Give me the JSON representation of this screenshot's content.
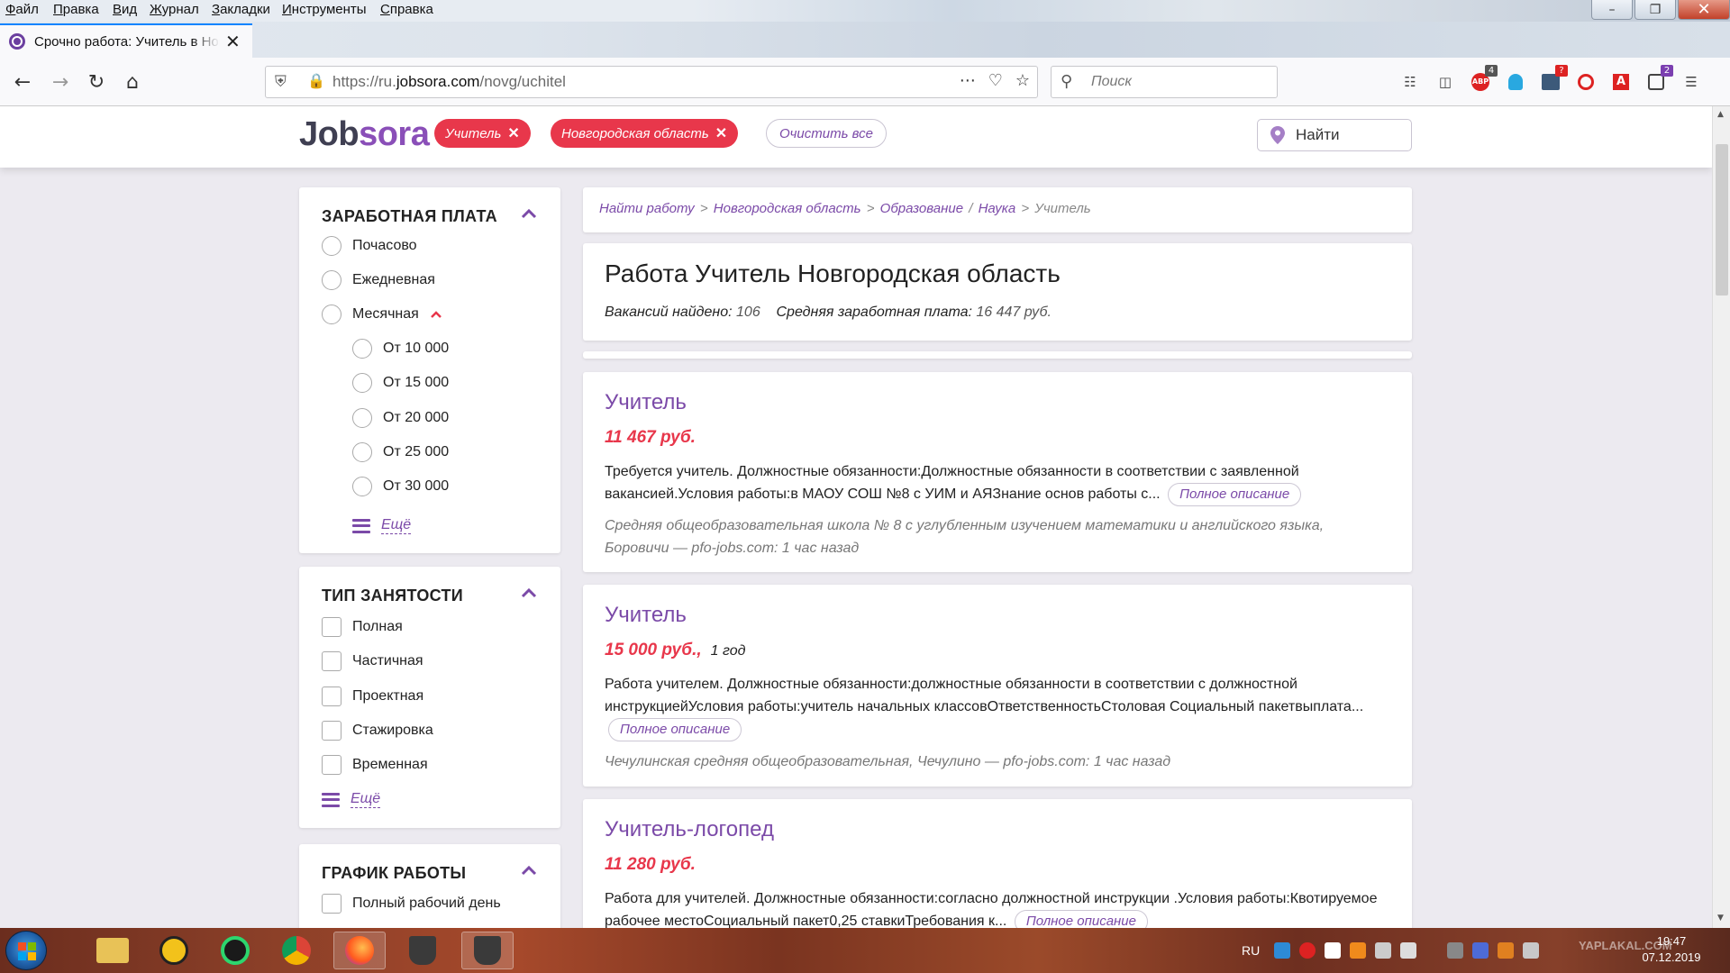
{
  "browser": {
    "menu": [
      "Файл",
      "Правка",
      "Вид",
      "Журнал",
      "Закладки",
      "Инструменты",
      "Справка"
    ],
    "tab_title": "Срочно работа: Учитель в Новгородская область",
    "url_prefix": "https://ru.",
    "url_domain": "jobsora.com",
    "url_path": "/novg/uchitel",
    "search_placeholder": "Поиск",
    "badges": {
      "abp": "4",
      "ext_red": "?",
      "ext_purple": "2"
    }
  },
  "header": {
    "logo_part1": "Job",
    "logo_part2": "sora",
    "chips": [
      "Учитель",
      "Новгородская область"
    ],
    "clear_all": "Очистить все",
    "find": "Найти"
  },
  "filters": {
    "salary": {
      "title": "ЗАРАБОТНАЯ ПЛАТА",
      "options": [
        "Почасово",
        "Ежедневная",
        "Месячная"
      ],
      "suboptions": [
        "От 10 000",
        "От 15 000",
        "От 20 000",
        "От 25 000",
        "От 30 000"
      ],
      "more": "Ещё"
    },
    "employment": {
      "title": "ТИП ЗАНЯТОСТИ",
      "options": [
        "Полная",
        "Частичная",
        "Проектная",
        "Стажировка",
        "Временная"
      ],
      "more": "Ещё"
    },
    "schedule": {
      "title": "ГРАФИК РАБОТЫ",
      "options": [
        "Полный рабочий день"
      ]
    }
  },
  "breadcrumb": [
    "Найти работу",
    "Новгородская область",
    "Образование",
    "Наука",
    "Учитель"
  ],
  "summary": {
    "title": "Работа Учитель Новгородская область",
    "found_label": "Вакансий найдено:",
    "found_value": "106",
    "avg_label": "Средняя заработная плата:",
    "avg_value": "16 447 руб."
  },
  "jobs": [
    {
      "title": "Учитель",
      "salary": "11 467 руб.",
      "term": "",
      "desc": "Требуется учитель. Должностные обязанности:Должностные обязанности в соответствии с заявленной вакансией.Условия работы:в МАОУ СОШ №8 с УИМ и АЯЗнание основ работы с...",
      "full": "Полное описание",
      "meta": "Средняя общеобразовательная школа № 8 с углубленным изучением математики и английского языка, Боровичи — pfo-jobs.com: 1 час назад"
    },
    {
      "title": "Учитель",
      "salary": "15 000 руб.,",
      "term": "1 год",
      "desc": "Работа учителем. Должностные обязанности:должностные обязанности в соответствии с должностной инструкциейУсловия работы:учитель начальных классовОтветственностьСтоловая Социальный пакетвыплата...",
      "full": "Полное описание",
      "meta": "Чечулинская средняя общеобразовательная, Чечулино — pfo-jobs.com: 1 час назад"
    },
    {
      "title": "Учитель-логопед",
      "salary": "11 280 руб.",
      "term": "",
      "desc": "Работа для учителей. Должностные обязанности:согласно должностной инструкции .Условия работы:Квотируемое рабочее местоСоциальный пакет0,25 ставкиТребования к...",
      "full": "Полное описание",
      "meta": ""
    }
  ],
  "taskbar": {
    "lang": "RU",
    "time": "19:47",
    "date": "07.12.2019",
    "watermark": "YAPLAKAL.COM"
  },
  "colors": {
    "accent_purple": "#7b4aa8",
    "accent_red": "#e8374b",
    "page_bg": "#eceaf0"
  }
}
